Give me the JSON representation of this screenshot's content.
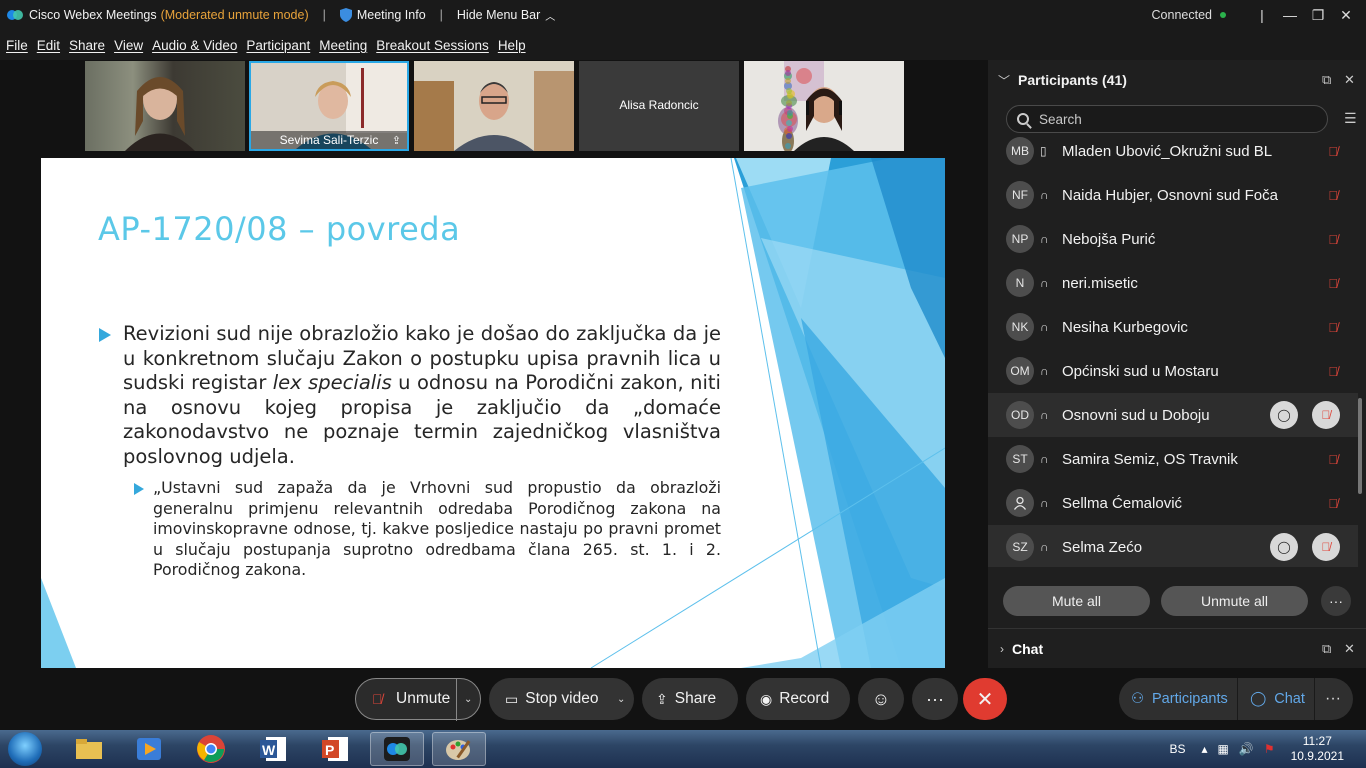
{
  "titlebar": {
    "app_title": "Cisco Webex Meetings",
    "mode": "(Moderated unmute mode)",
    "meeting_info": "Meeting Info",
    "hide_menu_bar": "Hide Menu Bar",
    "connection_status": "Connected",
    "status_color": "#2bb24c"
  },
  "menu": [
    "File",
    "Edit",
    "Share",
    "View",
    "Audio & Video",
    "Participant",
    "Meeting",
    "Breakout Sessions",
    "Help"
  ],
  "video_tiles": [
    {
      "name": ""
    },
    {
      "name": "Sevima Sali-Terzic"
    },
    {
      "name": ""
    },
    {
      "name": "Alisa Radoncic"
    },
    {
      "name": ""
    }
  ],
  "slide": {
    "title": "AP-1720/08 – povreda",
    "bullet1_a": "Revizioni sud nije obrazložio kako je došao do zaključka da je u konkretnom slučaju Zakon o postupku upisa pravnih lica u sudski registar ",
    "bullet1_italic": "lex specialis",
    "bullet1_b": " u odnosu na Porodični zakon, niti na osnovu kojeg propisa je zaključio da „domaće zakonodavstvo ne poznaje termin zajedničkog vlasništva poslovnog udjela.",
    "bullet2": "„Ustavni sud zapaža da je Vrhovni sud propustio da obrazloži generalnu primjenu relevantnih odredaba Porodičnog zakona na imovinskopravne odnose, tj. kakve posljedice nastaju po pravni promet u slučaju postupanja suprotno odredbama člana 265. st. 1. i 2. Porodičnog zakona.",
    "accent_color": "#35a8dc"
  },
  "participants_panel": {
    "title": "Participants (41)",
    "search_placeholder": "Search",
    "rows": [
      {
        "initials": "MB",
        "name": "Mladen Ubović_Okružni sud BL"
      },
      {
        "initials": "NF",
        "name": "Naida Hubjer, Osnovni sud Foča"
      },
      {
        "initials": "NP",
        "name": "Nebojša Purić"
      },
      {
        "initials": "N",
        "name": "neri.misetic"
      },
      {
        "initials": "NK",
        "name": "Nesiha Kurbegovic"
      },
      {
        "initials": "OM",
        "name": "Općinski sud u Mostaru"
      },
      {
        "initials": "OD",
        "name": "Osnovni sud u Doboju"
      },
      {
        "initials": "ST",
        "name": "Samira Semiz, OS Travnik"
      },
      {
        "initials": "",
        "name": "Sellma Ćemalović"
      },
      {
        "initials": "SZ",
        "name": "Selma Zećo"
      }
    ],
    "mute_all": "Mute all",
    "unmute_all": "Unmute all",
    "chat_title": "Chat"
  },
  "controls": {
    "unmute": "Unmute",
    "stop_video": "Stop video",
    "share": "Share",
    "record": "Record",
    "participants": "Participants",
    "chat": "Chat"
  },
  "taskbar": {
    "language": "BS",
    "time": "11:27",
    "date": "10.9.2021"
  }
}
